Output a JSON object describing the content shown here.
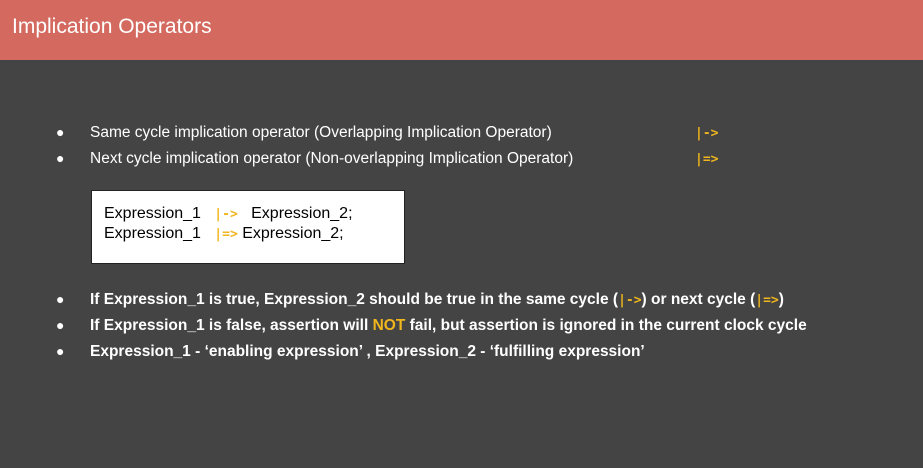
{
  "title": "Implication Operators",
  "top_bullets": [
    {
      "bullet": "●",
      "text": "Same cycle implication operator  (Overlapping Implication Operator)",
      "operator": "|->"
    },
    {
      "bullet": "●",
      "text": "Next cycle implication operator   (Non-overlapping Implication Operator)",
      "operator": "|=>"
    }
  ],
  "code_box": {
    "lines": [
      {
        "lhs": "Expression_1",
        "op": "|->",
        "rhs": "Expression_2;"
      },
      {
        "lhs": "Expression_1",
        "op": "|=>",
        "rhs": "Expression_2;"
      }
    ]
  },
  "bottom_bullets": [
    {
      "bullet": "●",
      "part1": "If Expression_1 is true, Expression_2 should be true in the same cycle (",
      "op1": "|->",
      "part2": ") or next cycle (",
      "op2": "|=>",
      "part3": ")"
    },
    {
      "bullet": "●",
      "part1": "If Expression_1 is false, assertion will ",
      "highlight": "NOT",
      "part2": " fail, but assertion is ignored in the current clock cycle"
    },
    {
      "bullet": "●",
      "text": "Expression_1 -  ‘enabling expression’ , Expression_2 -  ‘fulfilling expression’"
    }
  ],
  "colors": {
    "title_bar": "#d46a5f",
    "background": "#444444",
    "accent": "#f1b61d"
  }
}
